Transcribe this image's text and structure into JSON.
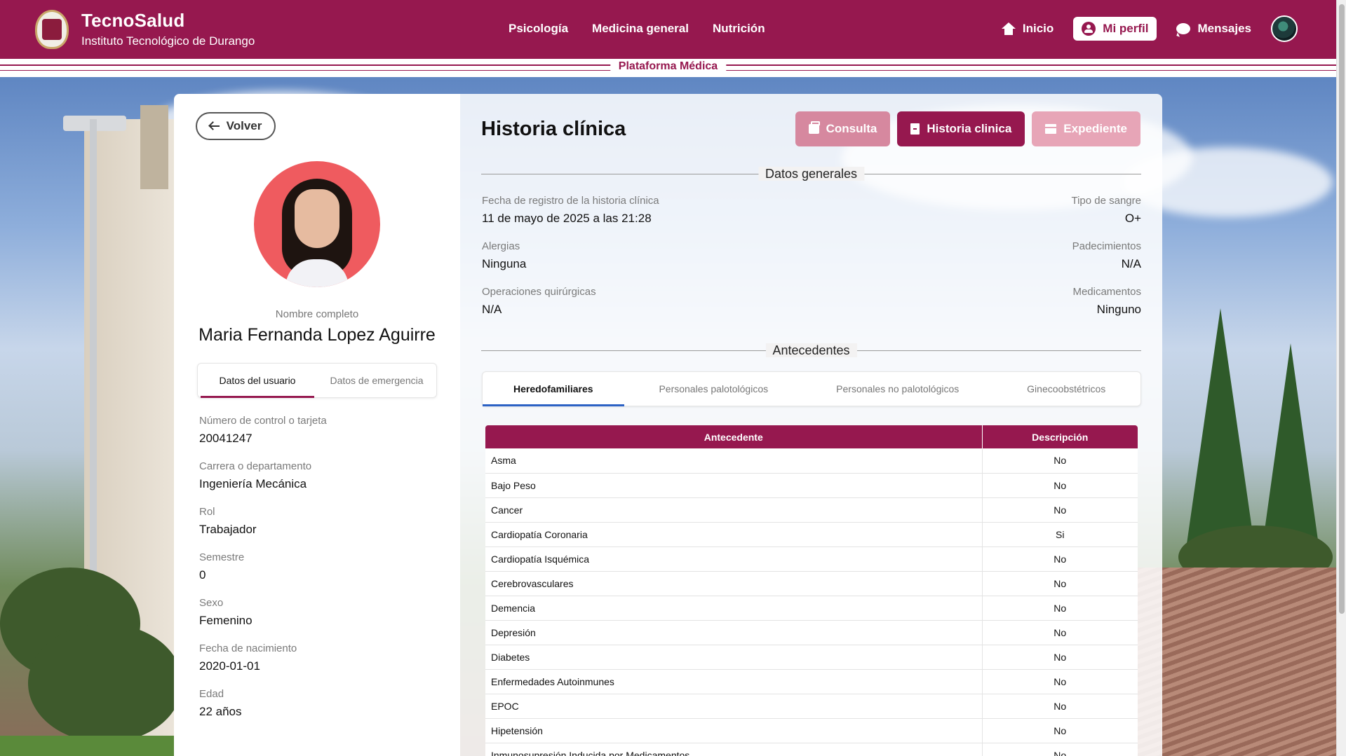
{
  "header": {
    "brand_name": "TecnoSalud",
    "brand_sub": "Instituto Tecnológico de Durango",
    "nav": [
      "Psicología",
      "Medicina general",
      "Nutrición"
    ],
    "inicio": "Inicio",
    "mi_perfil": "Mi perfil",
    "mensajes": "Mensajes",
    "platform_title": "Plataforma Médica"
  },
  "left": {
    "back_label": "Volver",
    "name_label": "Nombre completo",
    "full_name": "Maria Fernanda Lopez Aguirre",
    "tabs": [
      "Datos del usuario",
      "Datos de emergencia"
    ],
    "fields": [
      {
        "label": "Número de control o tarjeta",
        "value": "20041247"
      },
      {
        "label": "Carrera o departamento",
        "value": "Ingeniería Mecánica"
      },
      {
        "label": "Rol",
        "value": "Trabajador"
      },
      {
        "label": "Semestre",
        "value": "0"
      },
      {
        "label": "Sexo",
        "value": "Femenino"
      },
      {
        "label": "Fecha de nacimiento",
        "value": "2020-01-01"
      },
      {
        "label": "Edad",
        "value": "22 años"
      }
    ]
  },
  "main": {
    "title": "Historia clínica",
    "actions": [
      "Consulta",
      "Historia clinica",
      "Expediente"
    ],
    "general_title": "Datos generales",
    "general": {
      "fecha_label": "Fecha de registro de la historia clínica",
      "fecha_value": "11 de mayo de 2025 a las 21:28",
      "sangre_label": "Tipo de sangre",
      "sangre_value": "O+",
      "alergias_label": "Alergias",
      "alergias_value": "Ninguna",
      "padecimientos_label": "Padecimientos",
      "padecimientos_value": "N/A",
      "operaciones_label": "Operaciones quirúrgicas",
      "operaciones_value": "N/A",
      "medicamentos_label": "Medicamentos",
      "medicamentos_value": "Ninguno"
    },
    "antecedentes_title": "Antecedentes",
    "tabs": [
      "Heredofamiliares",
      "Personales palotológicos",
      "Personales no palotológicos",
      "Ginecoobstétricos"
    ],
    "table": {
      "headers": [
        "Antecedente",
        "Descripción"
      ],
      "rows": [
        [
          "Asma",
          "No"
        ],
        [
          "Bajo Peso",
          "No"
        ],
        [
          "Cancer",
          "No"
        ],
        [
          "Cardiopatía Coronaria",
          "Si"
        ],
        [
          "Cardiopatía Isquémica",
          "No"
        ],
        [
          "Cerebrovasculares",
          "No"
        ],
        [
          "Demencia",
          "No"
        ],
        [
          "Depresión",
          "No"
        ],
        [
          "Diabetes",
          "No"
        ],
        [
          "Enfermedades Autoinmunes",
          "No"
        ],
        [
          "EPOC",
          "No"
        ],
        [
          "Hipetensión",
          "No"
        ],
        [
          "Inmunosupresión Inducida por Medicamentos",
          "No"
        ]
      ]
    }
  },
  "colors": {
    "brand": "#96184f",
    "tab_underline": "#2c62c4"
  }
}
